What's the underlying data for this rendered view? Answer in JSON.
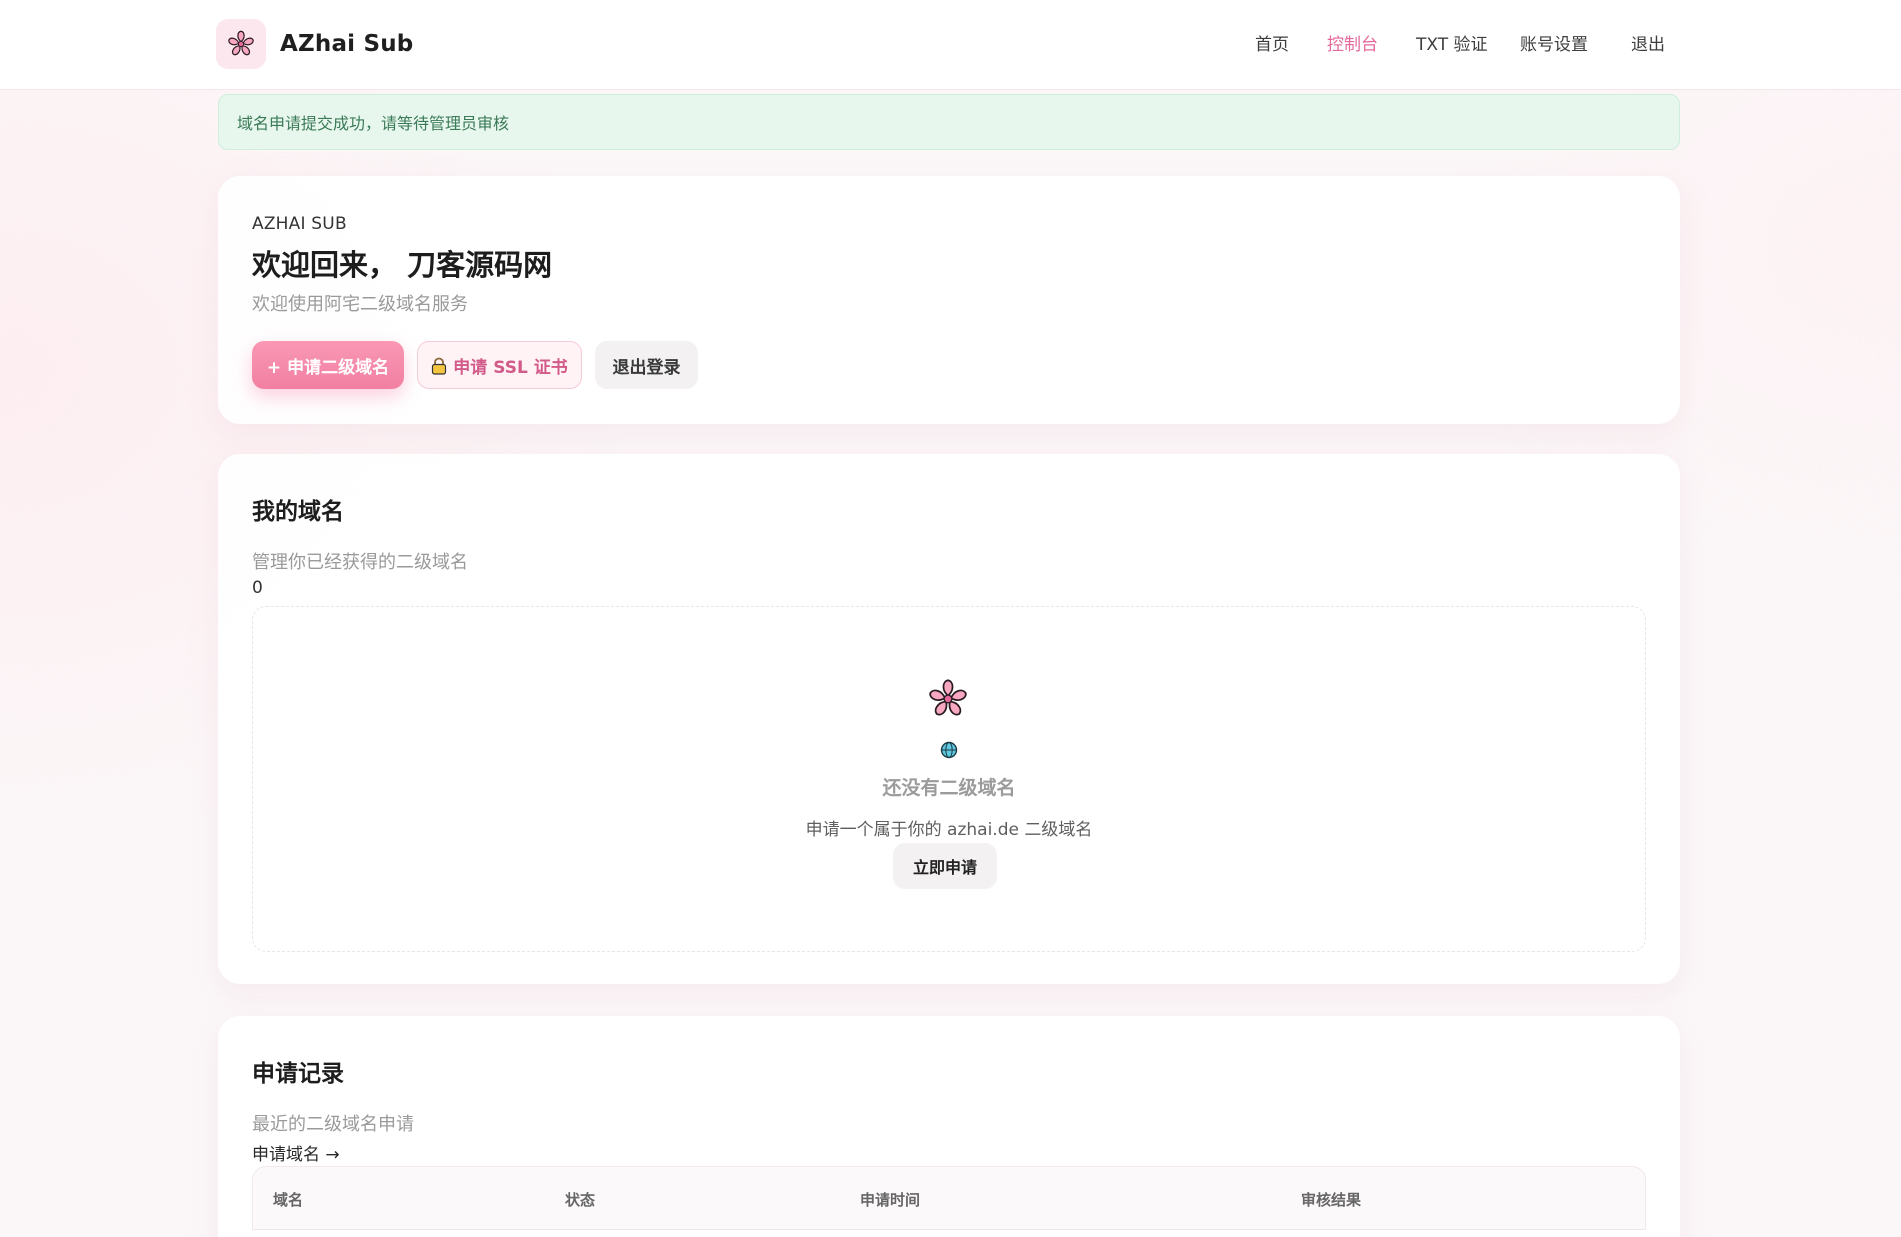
{
  "header": {
    "brand": "AZhai Sub",
    "nav": [
      {
        "label": "首页",
        "active": false
      },
      {
        "label": "控制台",
        "active": true
      },
      {
        "label": "TXT 验证",
        "active": false
      },
      {
        "label": "账号设置",
        "active": false
      },
      {
        "label": "退出",
        "active": false
      }
    ]
  },
  "alert": {
    "message": "域名申请提交成功，请等待管理员审核",
    "type": "success"
  },
  "hero": {
    "eyebrow": "AZHAI SUB",
    "title": "欢迎回来， 刀客源码网",
    "subtitle": "欢迎使用阿宅二级域名服务",
    "buttons": {
      "apply_domain": "+ 申请二级域名",
      "apply_ssl": "申请 SSL 证书",
      "logout": "退出登录"
    }
  },
  "domains": {
    "title": "我的域名",
    "subtitle": "管理你已经获得的二级域名",
    "count": "0",
    "empty": {
      "title": "还没有二级域名",
      "description": "申请一个属于你的 azhai.de 二级域名",
      "button": "立即申请"
    }
  },
  "records": {
    "title": "申请记录",
    "subtitle": "最近的二级域名申请",
    "link": "申请域名 →",
    "columns": [
      "域名",
      "状态",
      "申请时间",
      "审核结果"
    ]
  },
  "colors": {
    "accent": "#e5689a",
    "primary_button": "#f27fa3",
    "alert_bg": "#e8f7ee",
    "alert_text": "#3a7a56"
  },
  "icons": {
    "brand": "cherry-blossom-icon",
    "ssl": "lock-icon",
    "empty_flower": "cherry-blossom-icon",
    "empty_globe": "globe-icon"
  }
}
